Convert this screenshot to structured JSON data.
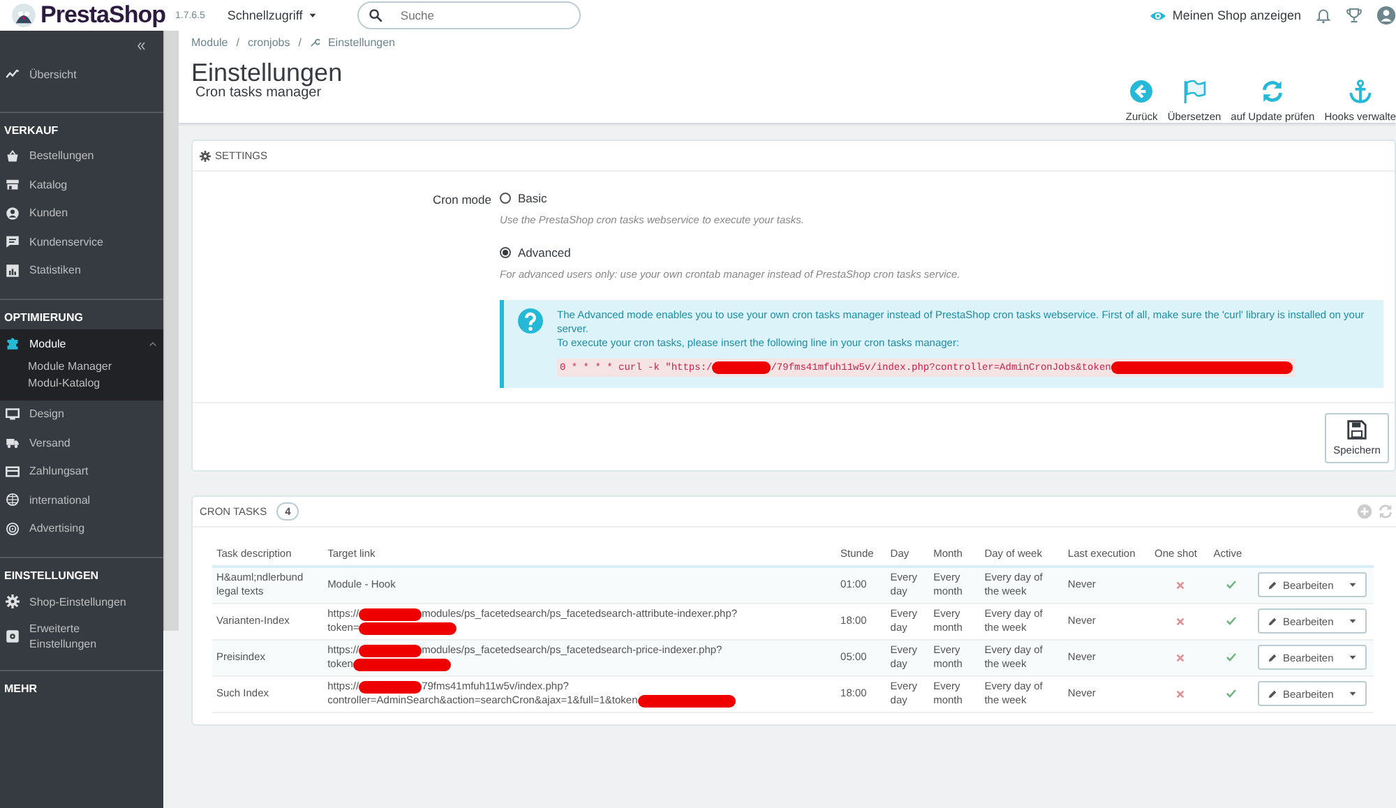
{
  "topbar": {
    "logo": "PrestaShop",
    "version": "1.7.6.5",
    "quick_access": "Schnellzugriff",
    "search": {
      "placeholder": "Suche"
    },
    "view_shop": "Meinen Shop anzeigen"
  },
  "sidebar": {
    "sections": [
      {
        "items": [
          {
            "label": "Übersicht",
            "selected": false
          }
        ]
      },
      {
        "title": "VERKAUF",
        "items": [
          {
            "label": "Bestellungen",
            "selected": false
          },
          {
            "label": "Katalog",
            "selected": false
          },
          {
            "label": "Kunden",
            "selected": false
          },
          {
            "label": "Kundenservice",
            "selected": false
          },
          {
            "label": "Statistiken",
            "selected": false
          }
        ]
      },
      {
        "title": "OPTIMIERUNG",
        "items": [
          {
            "label": "Module",
            "selected": true,
            "expanded": true,
            "children": [
              {
                "label": "Module Manager"
              },
              {
                "label": "Modul-Katalog"
              }
            ]
          },
          {
            "label": "Design",
            "selected": false
          },
          {
            "label": "Versand",
            "selected": false
          },
          {
            "label": "Zahlungsart",
            "selected": false
          },
          {
            "label": "international",
            "selected": false
          },
          {
            "label": "Advertising",
            "selected": false
          }
        ]
      },
      {
        "title": "EINSTELLUNGEN",
        "items": [
          {
            "label": "Shop-Einstellungen",
            "selected": false
          },
          {
            "label": "Erweiterte Einstellungen",
            "selected": false
          }
        ]
      },
      {
        "title": "MEHR"
      }
    ]
  },
  "header": {
    "breadcrumb": [
      {
        "label": "Module",
        "separator": "/"
      },
      {
        "label": "cronjobs",
        "separator": "/"
      },
      {
        "label": "Einstellungen"
      }
    ],
    "title": "Einstellungen",
    "subtitle": "Cron tasks manager",
    "toolbar": [
      {
        "label": "Zurück"
      },
      {
        "label": "Übersetzen"
      },
      {
        "label": "auf Update prüfen"
      },
      {
        "label": "Hooks verwalte"
      }
    ]
  },
  "settings": {
    "title": "SETTINGS",
    "field_label": "Cron mode",
    "options": [
      {
        "label": "Basic",
        "description": "Use the PrestaShop cron tasks webservice to execute your tasks.",
        "selected": false
      },
      {
        "label": "Advanced",
        "description": "For advanced users only: use your own crontab manager instead of PrestaShop cron tasks service.",
        "selected": true
      }
    ],
    "info": [
      "The Advanced mode enables you to use your own cron tasks manager instead of PrestaShop cron tasks webservice. First of all, make sure the 'curl' library is installed on your server.",
      "To execute your cron tasks, please insert the following line in your cron tasks manager:"
    ],
    "command": [
      {
        "kind": "text",
        "text": "0 * * * * curl -k \"https:/"
      },
      {
        "kind": "redacted"
      },
      {
        "kind": "text",
        "text": "/79fms41mfuh11w5v/index.php?controller=AdminCronJobs&token"
      },
      {
        "kind": "redacted"
      }
    ],
    "save": "Speichern"
  },
  "cron_tasks": {
    "title": "CRON TASKS",
    "count": "4",
    "columns": [
      "Task description",
      "Target link",
      "Stunde",
      "Day",
      "Month",
      "Day of week",
      "Last execution",
      "One shot",
      "Active"
    ],
    "rows": [
      {
        "description": "H&auml;ndlerbund legal texts",
        "link": [
          [
            {
              "kind": "text",
              "text": "Module - Hook"
            }
          ]
        ],
        "hour": "01:00",
        "day": "Every day",
        "month": "Every month",
        "weekday": "Every day of the week",
        "last": "Never",
        "one_shot": false,
        "active": true,
        "action": "Bearbeiten"
      },
      {
        "description": "Varianten-Index",
        "link": [
          [
            {
              "kind": "text",
              "text": "https://"
            },
            {
              "kind": "redacted"
            },
            {
              "kind": "text",
              "text": "modules/ps_facetedsearch/ps_facetedsearch-attribute-indexer.php?"
            }
          ],
          [
            {
              "kind": "text",
              "text": "token="
            },
            {
              "kind": "redacted"
            }
          ]
        ],
        "hour": "18:00",
        "day": "Every day",
        "month": "Every month",
        "weekday": "Every day of the week",
        "last": "Never",
        "one_shot": false,
        "active": true,
        "action": "Bearbeiten"
      },
      {
        "description": "Preisindex",
        "link": [
          [
            {
              "kind": "text",
              "text": "https://"
            },
            {
              "kind": "redacted"
            },
            {
              "kind": "text",
              "text": "modules/ps_facetedsearch/ps_facetedsearch-price-indexer.php?"
            }
          ],
          [
            {
              "kind": "text",
              "text": "token"
            },
            {
              "kind": "redacted"
            }
          ]
        ],
        "hour": "05:00",
        "day": "Every day",
        "month": "Every month",
        "weekday": "Every day of the week",
        "last": "Never",
        "one_shot": false,
        "active": true,
        "action": "Bearbeiten"
      },
      {
        "description": "Such Index",
        "link": [
          [
            {
              "kind": "text",
              "text": "https://"
            },
            {
              "kind": "redacted"
            },
            {
              "kind": "text",
              "text": "79fms41mfuh11w5v/index.php?"
            }
          ],
          [
            {
              "kind": "text",
              "text": "controller=AdminSearch&action=searchCron&ajax=1&full=1&token"
            },
            {
              "kind": "redacted"
            }
          ]
        ],
        "hour": "18:00",
        "day": "Every day",
        "month": "Every month",
        "weekday": "Every day of the week",
        "last": "Never",
        "one_shot": false,
        "active": true,
        "action": "Bearbeiten"
      }
    ]
  }
}
